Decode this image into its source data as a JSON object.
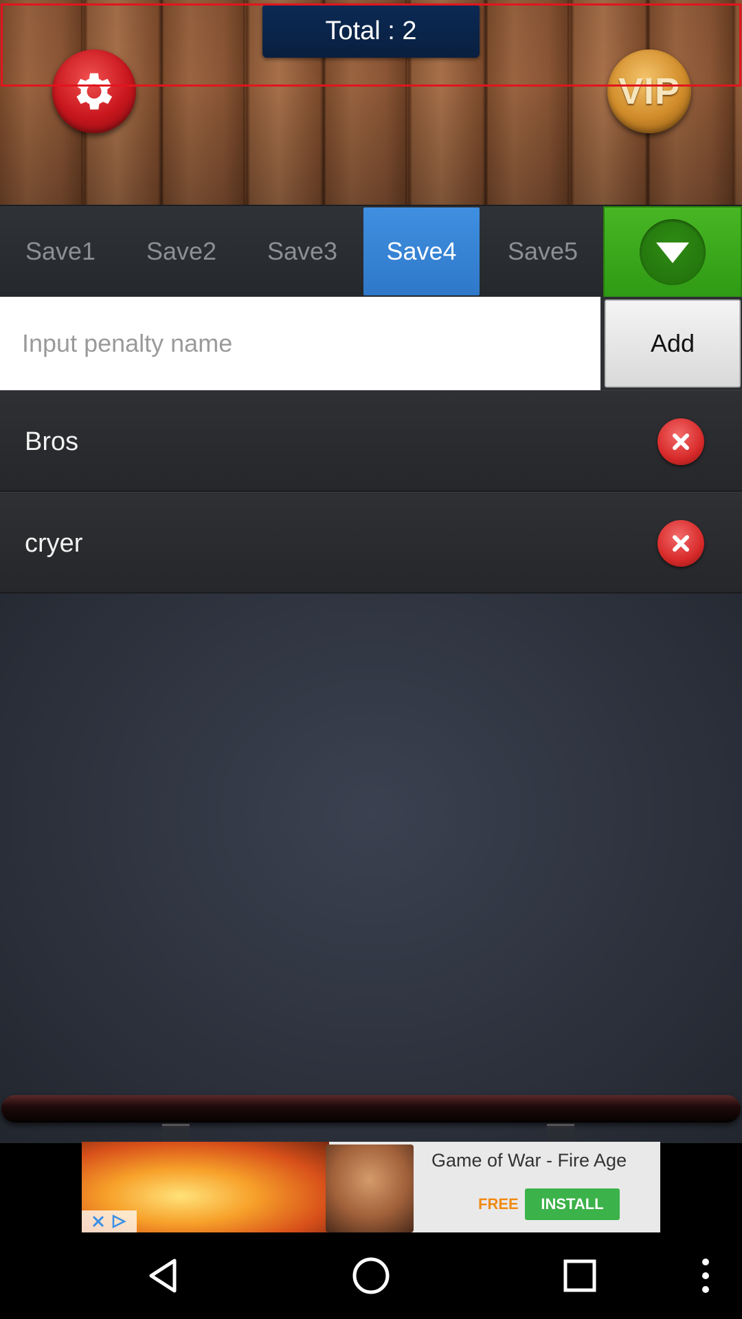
{
  "header": {
    "total_text": "Total : 2",
    "vip_label": "VIP"
  },
  "tabs": [
    {
      "label": "Save1",
      "active": false
    },
    {
      "label": "Save2",
      "active": false
    },
    {
      "label": "Save3",
      "active": false
    },
    {
      "label": "Save4",
      "active": true
    },
    {
      "label": "Save5",
      "active": false
    }
  ],
  "input": {
    "placeholder": "Input penalty name",
    "value": "",
    "add_label": "Add"
  },
  "penalties": [
    {
      "label": "Bros"
    },
    {
      "label": "cryer"
    }
  ],
  "ad": {
    "title": "Game of War - Fire Age",
    "free_label": "FREE",
    "install_label": "INSTALL"
  },
  "colors": {
    "active_tab": "#3f8fe0",
    "dropdown_green": "#48b624",
    "delete_red": "#d82a2a",
    "settings_red": "#c8161d",
    "vip_gold": "#d18c2a",
    "highlight_red": "#e3141e"
  },
  "icons": {
    "settings": "gear-icon",
    "dropdown": "chevron-down-icon",
    "delete": "close-icon",
    "nav_back": "back-icon",
    "nav_home": "home-icon",
    "nav_recents": "recents-icon",
    "nav_menu": "more-vert-icon"
  }
}
